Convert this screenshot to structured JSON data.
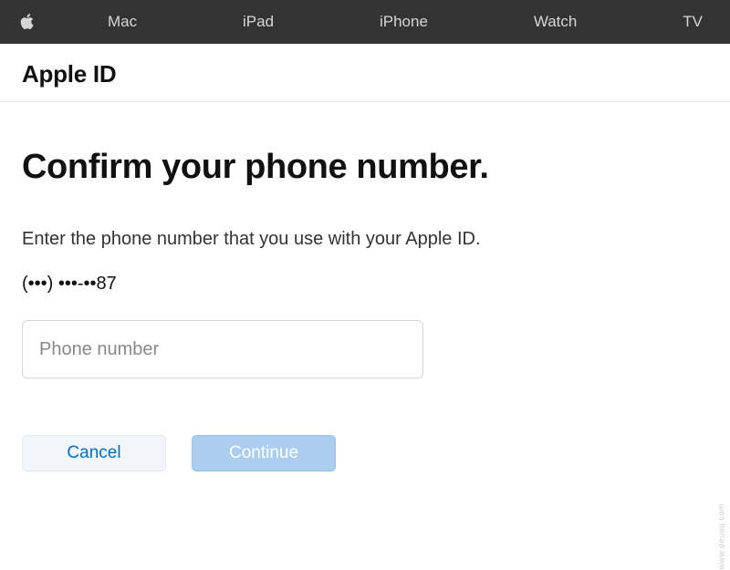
{
  "nav": {
    "items": [
      "Mac",
      "iPad",
      "iPhone",
      "Watch",
      "TV"
    ]
  },
  "header": {
    "title": "Apple ID"
  },
  "main": {
    "headline": "Confirm your phone number.",
    "instruction": "Enter the phone number that you use with your Apple ID.",
    "masked_number": "(•••) •••-••87",
    "phone_placeholder": "Phone number"
  },
  "buttons": {
    "cancel": "Cancel",
    "continue": "Continue"
  },
  "watermark": "www.deuaq.com"
}
